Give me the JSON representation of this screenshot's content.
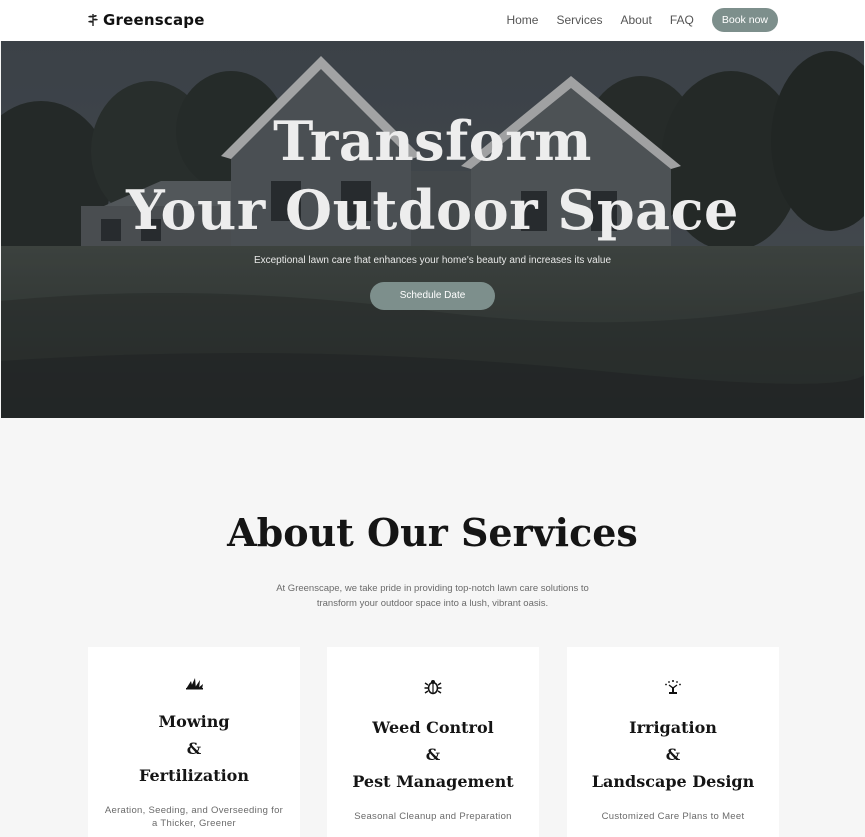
{
  "brand": {
    "name": "Greenscape",
    "logo_icon": "leaf-sprig-icon"
  },
  "nav": {
    "links": [
      "Home",
      "Services",
      "About",
      "FAQ"
    ],
    "cta_label": "Book now",
    "cta_color": "#7d8f8c"
  },
  "hero": {
    "title_line1": "Transform",
    "title_line2": "Your Outdoor Space",
    "subtitle": "Exceptional lawn care that enhances your home's beauty and increases its value",
    "button_label": "Schedule Date"
  },
  "about": {
    "title": "About Our Services",
    "description": "At Greenscape, we take pride in providing top-notch lawn care solutions to transform your outdoor space into a lush, vibrant oasis."
  },
  "services": [
    {
      "icon": "grass-icon",
      "title_line1": "Mowing",
      "amp": "&",
      "title_line2": "Fertilization",
      "text": "Aeration, Seeding, and Overseeding for a Thicker, Greener"
    },
    {
      "icon": "bug-icon",
      "title_line1": "Weed Control",
      "amp": "&",
      "title_line2": "Pest Management",
      "text": "Seasonal Cleanup and Preparation"
    },
    {
      "icon": "sprinkler-icon",
      "title_line1": "Irrigation",
      "amp": "&",
      "title_line2": "Landscape Design",
      "text": "Customized Care Plans to Meet"
    }
  ],
  "colors": {
    "accent": "#7d8f8c",
    "page_bg": "#f6f6f6"
  }
}
